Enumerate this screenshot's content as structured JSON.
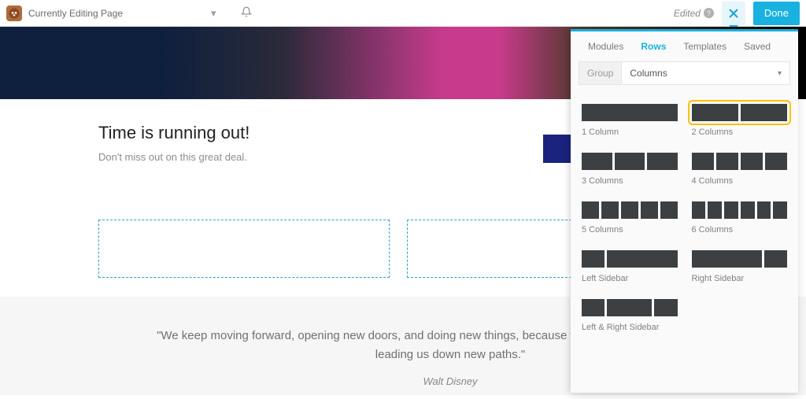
{
  "header": {
    "page_title": "Currently Editing Page",
    "edited_label": "Edited",
    "done_label": "Done"
  },
  "content": {
    "headline": "Time is running out!",
    "subtext": "Don't miss out on this great deal.",
    "quote": "\"We keep moving forward, opening new doors, and doing new things, because we're curious and curiosity keeps leading us down new paths.\"",
    "quote_author": "Walt Disney"
  },
  "panel": {
    "tabs": {
      "modules": "Modules",
      "rows": "Rows",
      "templates": "Templates",
      "saved": "Saved"
    },
    "filter": {
      "group_label": "Group",
      "selected": "Columns"
    },
    "rows": {
      "one": "1 Column",
      "two": "2 Columns",
      "three": "3 Columns",
      "four": "4 Columns",
      "five": "5 Columns",
      "six": "6 Columns",
      "left_sidebar": "Left Sidebar",
      "right_sidebar": "Right Sidebar",
      "lr_sidebar": "Left & Right Sidebar"
    }
  }
}
